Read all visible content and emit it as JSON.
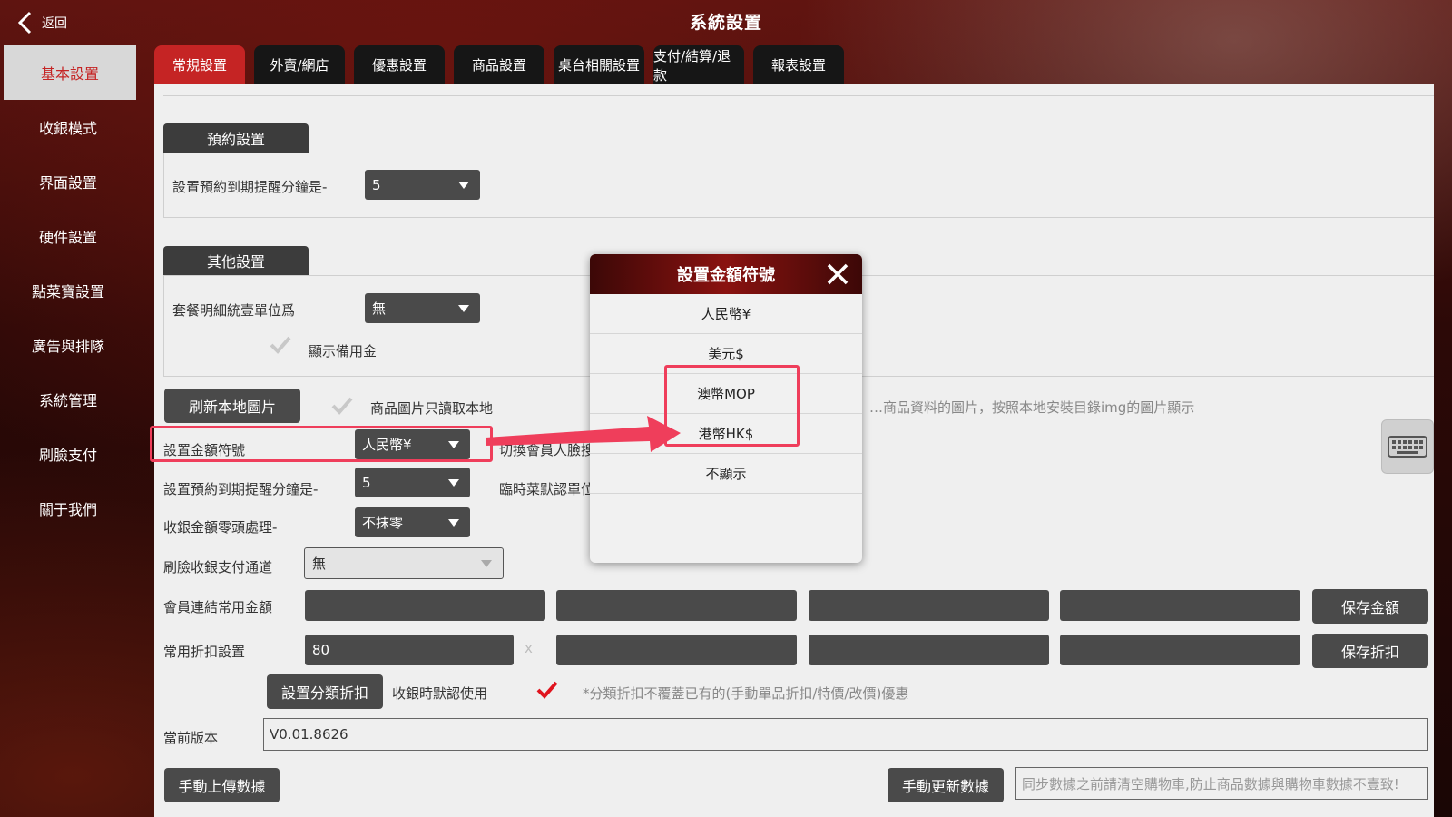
{
  "header": {
    "back_label": "返回",
    "title": "系統設置"
  },
  "sidebar": {
    "items": [
      {
        "label": "基本設置"
      },
      {
        "label": "收銀模式"
      },
      {
        "label": "界面設置"
      },
      {
        "label": "硬件設置"
      },
      {
        "label": "點菜寶設置"
      },
      {
        "label": "廣告與排隊"
      },
      {
        "label": "系統管理"
      },
      {
        "label": "刷臉支付"
      },
      {
        "label": "關于我們"
      }
    ]
  },
  "tabs": [
    {
      "label": "常規設置"
    },
    {
      "label": "外賣/網店"
    },
    {
      "label": "優惠設置"
    },
    {
      "label": "商品設置"
    },
    {
      "label": "桌台相關設置"
    },
    {
      "label": "支付/結算/退款"
    },
    {
      "label": "報表設置"
    }
  ],
  "reservation": {
    "section_label": "預約設置",
    "remind_label": "設置預約到期提醒分鐘是-",
    "remind_value": "5"
  },
  "other": {
    "section_label": "其他設置",
    "unit_label": "套餐明細統壹單位爲",
    "unit_value": "無",
    "show_reserve_label": "顯示備用金"
  },
  "images": {
    "refresh_button": "刷新本地圖片",
    "local_only_label": "商品圖片只讀取本地",
    "hint": "…商品資料的圖片，按照本地安裝目錄img的圖片顯示"
  },
  "settings": {
    "currency_label": "設置金額符號",
    "currency_value": "人民幣¥",
    "face_switch_label": "切換會員人臉搜",
    "remind2_label": "設置預約到期提醒分鐘是-",
    "remind2_value": "5",
    "temp_unit_label": "臨時菜默認單位",
    "rounding_label": "收銀金額零頭處理-",
    "rounding_value": "不抹零",
    "face_channel_label": "刷臉收銀支付通道",
    "face_channel_value": "無"
  },
  "member_amount": {
    "label": "會員連結常用金額",
    "values": [
      "",
      "",
      "",
      ""
    ],
    "save_button": "保存金額"
  },
  "discount": {
    "label": "常用折扣設置",
    "values": [
      "80",
      "",
      "",
      ""
    ],
    "clear_icon": "x",
    "save_button": "保存折扣"
  },
  "category_discount": {
    "button": "設置分類折扣",
    "default_use_label": "收銀時默認使用",
    "note": "*分類折扣不覆蓋已有的(手動單品折扣/特價/改價)優惠"
  },
  "version": {
    "label": "當前版本",
    "value": "V0.01.8626"
  },
  "sync": {
    "upload_button": "手動上傳數據",
    "update_button": "手動更新數據",
    "placeholder": "同步數據之前請清空購物車,防止商品數據與購物車數據不壹致!"
  },
  "modal": {
    "title": "設置金額符號",
    "options": [
      "人民幣¥",
      "美元$",
      "澳幣MOP",
      "港幣HK$",
      "不顯示"
    ]
  },
  "colors": {
    "accent": "#c52424",
    "annotation": "#ef3e5b",
    "panel": "#efefef",
    "dark_control": "#4a4a4a"
  }
}
